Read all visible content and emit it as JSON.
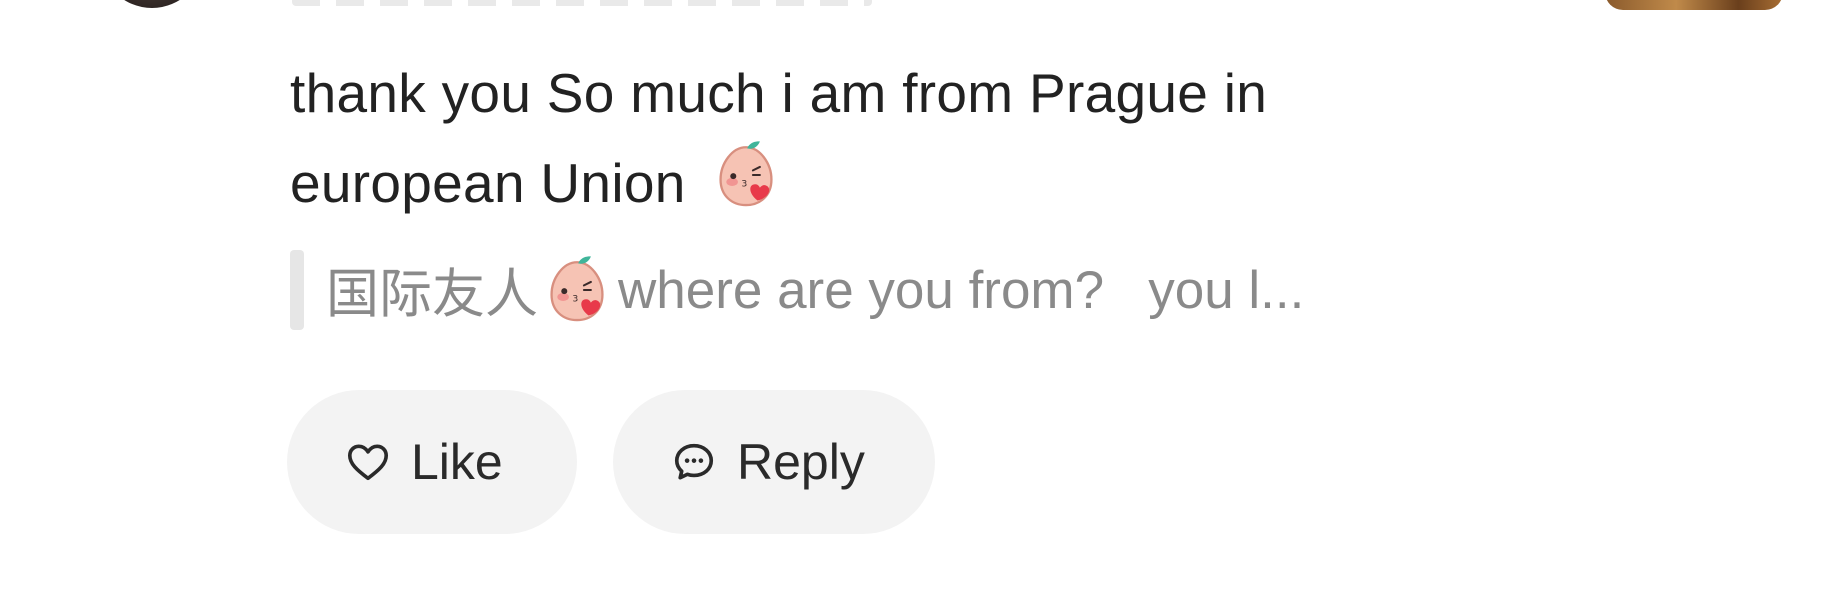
{
  "comment": {
    "line1": "thank you So much i am from Prague in",
    "line2": "european Union",
    "emoji": "blushing-peach-heart-emoji"
  },
  "quoted_reply": {
    "prefix": "国际友人",
    "text": "where are you from?   you l..."
  },
  "actions": {
    "like_label": "Like",
    "reply_label": "Reply",
    "like_icon": "heart-outline-icon",
    "reply_icon": "chat-bubble-icon"
  },
  "colors": {
    "text_primary": "#222222",
    "text_quote": "#8a8a8a",
    "pill_bg": "#f3f3f3",
    "quote_bar": "#e6e6e6"
  }
}
